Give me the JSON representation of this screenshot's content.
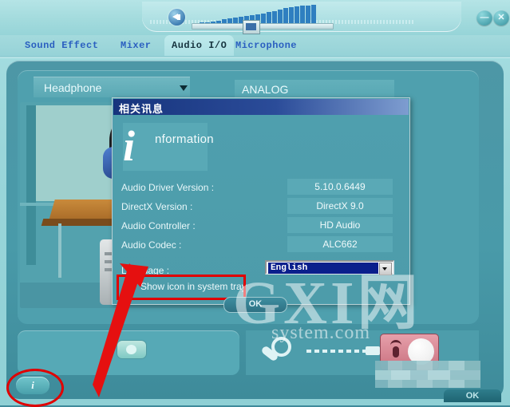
{
  "app": {
    "window_controls": {
      "minimize": "—",
      "close": "✕"
    },
    "volume": {
      "icon": "speaker-icon",
      "bar_heights": [
        3,
        4,
        4,
        5,
        6,
        8,
        9,
        10,
        11,
        12,
        13,
        14,
        15,
        17,
        18,
        20,
        22,
        23,
        24,
        25,
        25,
        26
      ],
      "thumb_position_pct": 52
    },
    "tabs": [
      {
        "label": "Sound Effect",
        "active": false
      },
      {
        "label": "Mixer",
        "active": false
      },
      {
        "label": "Audio I/O",
        "active": true
      },
      {
        "label": "Microphone",
        "active": false
      }
    ],
    "main": {
      "device_select_value": "Headphone",
      "connector_label": "ANALOG",
      "illustration_name": "desk-pc-headphone-illustration",
      "jacks": {
        "green_jack_name": "line-out-jack",
        "pink_jack_name": "microphone-jack"
      }
    },
    "info_button_glyph": "i",
    "bottom_ok_label": "OK"
  },
  "dialog": {
    "title": "相关讯息",
    "header": {
      "i_glyph": "i",
      "word": "nformation"
    },
    "rows": [
      {
        "label": "Audio Driver Version :",
        "value": "5.10.0.6449"
      },
      {
        "label": "DirectX Version :",
        "value": "DirectX 9.0"
      },
      {
        "label": "Audio Controller :",
        "value": "HD Audio"
      },
      {
        "label": "Audio Codec :",
        "value": "ALC662"
      }
    ],
    "language": {
      "label": "Language :",
      "selected": "English"
    },
    "tray_checkbox": {
      "label": "Show icon in system tray",
      "checked": false
    },
    "ok_label": "OK"
  },
  "watermark": {
    "big": "GXI网",
    "small": "system.com"
  },
  "annotations": {
    "highlight_color": "#e00000",
    "arrow_name": "red-callout-arrow",
    "ellipse_name": "red-callout-ellipse"
  },
  "colors": {
    "panel": "#4fa0ae",
    "titlebar": "#a3dbdd",
    "tab_text": "#2a5fc0",
    "dialog_title_bar": "#17347d",
    "accent_red": "#e00000"
  }
}
